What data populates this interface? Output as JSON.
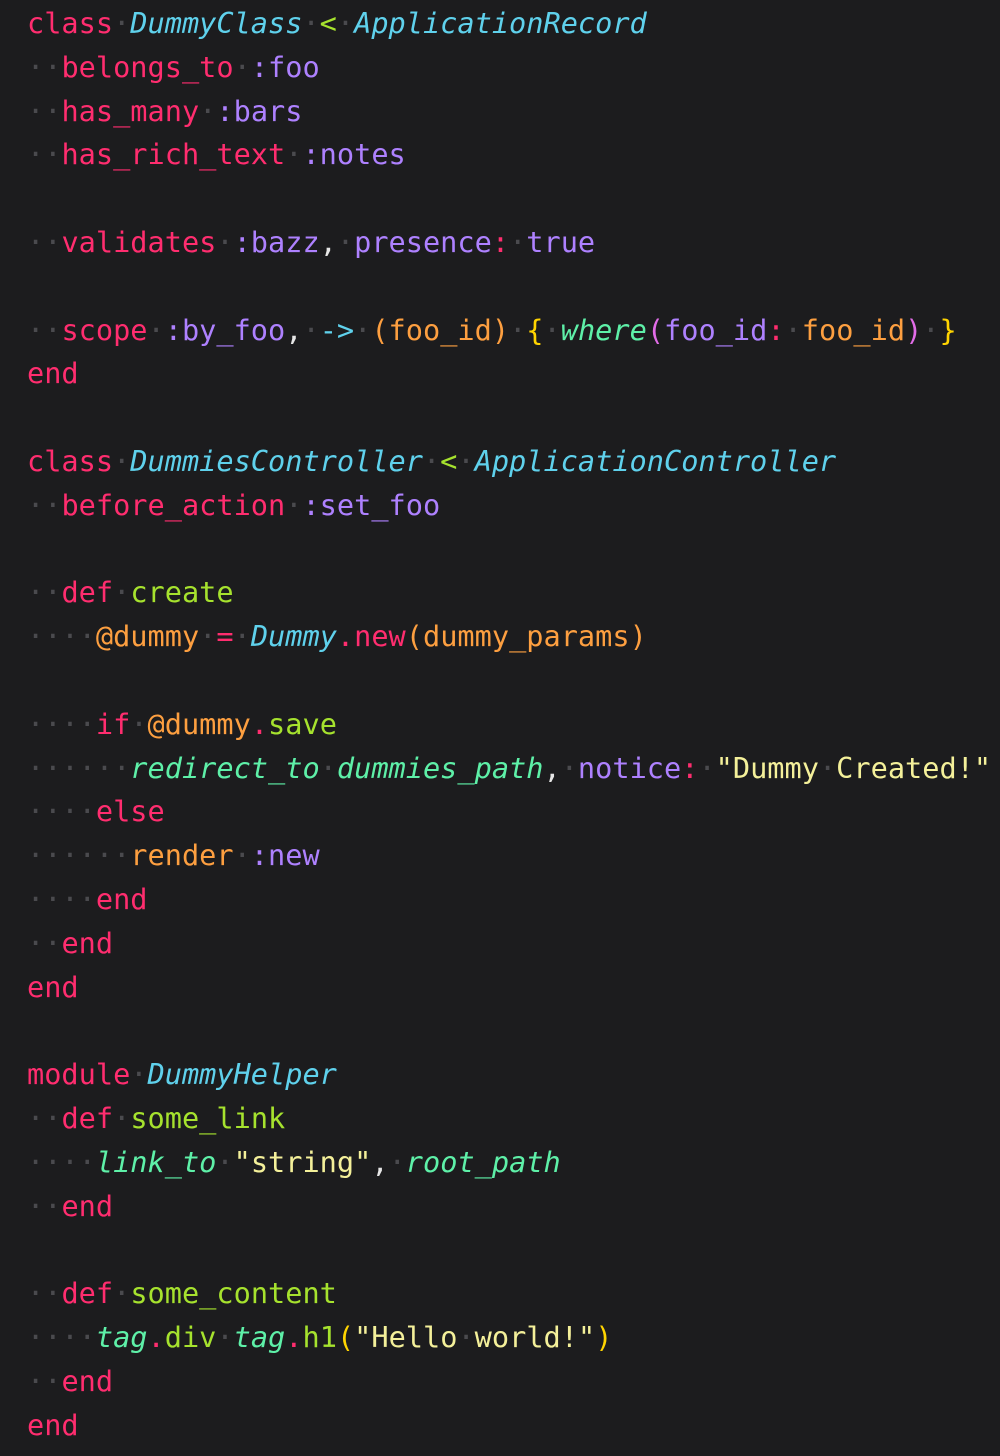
{
  "code": {
    "lines": [
      [
        [
          "kw",
          "class"
        ],
        [
          "ws",
          "·"
        ],
        [
          "cls",
          "DummyClass"
        ],
        [
          "ws",
          "·"
        ],
        [
          "op",
          "<"
        ],
        [
          "ws",
          "·"
        ],
        [
          "cls",
          "ApplicationRecord"
        ]
      ],
      [
        [
          "ws",
          "··"
        ],
        [
          "call",
          "belongs_to"
        ],
        [
          "ws",
          "·"
        ],
        [
          "sym",
          ":foo"
        ]
      ],
      [
        [
          "ws",
          "··"
        ],
        [
          "call",
          "has_many"
        ],
        [
          "ws",
          "·"
        ],
        [
          "sym",
          ":bars"
        ]
      ],
      [
        [
          "ws",
          "··"
        ],
        [
          "call",
          "has_rich_text"
        ],
        [
          "ws",
          "·"
        ],
        [
          "sym",
          ":notes"
        ]
      ],
      [],
      [
        [
          "ws",
          "··"
        ],
        [
          "call",
          "validates"
        ],
        [
          "ws",
          "·"
        ],
        [
          "sym",
          ":bazz"
        ],
        [
          "plain",
          ","
        ],
        [
          "ws",
          "·"
        ],
        [
          "sym",
          "presence"
        ],
        [
          "kw",
          ":"
        ],
        [
          "ws",
          "·"
        ],
        [
          "bool",
          "true"
        ]
      ],
      [],
      [
        [
          "ws",
          "··"
        ],
        [
          "call",
          "scope"
        ],
        [
          "ws",
          "·"
        ],
        [
          "sym",
          ":by_foo"
        ],
        [
          "plain",
          ","
        ],
        [
          "ws",
          "·"
        ],
        [
          "arrow",
          "->"
        ],
        [
          "ws",
          "·"
        ],
        [
          "var",
          "(foo_id)"
        ],
        [
          "ws",
          "·"
        ],
        [
          "brace",
          "{"
        ],
        [
          "ws",
          "·"
        ],
        [
          "fn-it",
          "where"
        ],
        [
          "paren",
          "("
        ],
        [
          "sym",
          "foo_id"
        ],
        [
          "kw",
          ":"
        ],
        [
          "ws",
          "·"
        ],
        [
          "var",
          "foo_id"
        ],
        [
          "paren",
          ")"
        ],
        [
          "ws",
          "·"
        ],
        [
          "brace",
          "}"
        ]
      ],
      [
        [
          "kw",
          "end"
        ]
      ],
      [],
      [
        [
          "kw",
          "class"
        ],
        [
          "ws",
          "·"
        ],
        [
          "cls",
          "DummiesController"
        ],
        [
          "ws",
          "·"
        ],
        [
          "op",
          "<"
        ],
        [
          "ws",
          "·"
        ],
        [
          "cls",
          "ApplicationController"
        ]
      ],
      [
        [
          "ws",
          "··"
        ],
        [
          "call",
          "before_action"
        ],
        [
          "ws",
          "·"
        ],
        [
          "sym",
          ":set_foo"
        ]
      ],
      [],
      [
        [
          "ws",
          "··"
        ],
        [
          "kw",
          "def"
        ],
        [
          "ws",
          "·"
        ],
        [
          "method",
          "create"
        ]
      ],
      [
        [
          "ws",
          "····"
        ],
        [
          "ivar",
          "@dummy"
        ],
        [
          "ws",
          "·"
        ],
        [
          "kw",
          "="
        ],
        [
          "ws",
          "·"
        ],
        [
          "cls",
          "Dummy"
        ],
        [
          "dot",
          "."
        ],
        [
          "kw",
          "new"
        ],
        [
          "var",
          "(dummy_params)"
        ]
      ],
      [],
      [
        [
          "ws",
          "····"
        ],
        [
          "kw",
          "if"
        ],
        [
          "ws",
          "·"
        ],
        [
          "ivar",
          "@dummy"
        ],
        [
          "dot",
          "."
        ],
        [
          "method",
          "save"
        ]
      ],
      [
        [
          "ws",
          "······"
        ],
        [
          "fn-it",
          "redirect_to"
        ],
        [
          "ws",
          "·"
        ],
        [
          "fn-it",
          "dummies_path"
        ],
        [
          "plain",
          ","
        ],
        [
          "ws",
          "·"
        ],
        [
          "sym",
          "notice"
        ],
        [
          "kw",
          ":"
        ],
        [
          "ws",
          "·"
        ],
        [
          "str",
          "\"Dummy"
        ],
        [
          "ws",
          "·"
        ],
        [
          "str",
          "Created!\""
        ]
      ],
      [
        [
          "ws",
          "····"
        ],
        [
          "kw",
          "else"
        ]
      ],
      [
        [
          "ws",
          "······"
        ],
        [
          "var",
          "render"
        ],
        [
          "ws",
          "·"
        ],
        [
          "sym",
          ":new"
        ]
      ],
      [
        [
          "ws",
          "····"
        ],
        [
          "kw",
          "end"
        ]
      ],
      [
        [
          "ws",
          "··"
        ],
        [
          "kw",
          "end"
        ]
      ],
      [
        [
          "kw",
          "end"
        ]
      ],
      [],
      [
        [
          "kw",
          "module"
        ],
        [
          "ws",
          "·"
        ],
        [
          "cls",
          "DummyHelper"
        ]
      ],
      [
        [
          "ws",
          "··"
        ],
        [
          "kw",
          "def"
        ],
        [
          "ws",
          "·"
        ],
        [
          "method",
          "some_link"
        ]
      ],
      [
        [
          "ws",
          "····"
        ],
        [
          "fn-it",
          "link_to"
        ],
        [
          "ws",
          "·"
        ],
        [
          "str",
          "\"string\""
        ],
        [
          "plain",
          ","
        ],
        [
          "ws",
          "·"
        ],
        [
          "fn-it",
          "root_path"
        ]
      ],
      [
        [
          "ws",
          "··"
        ],
        [
          "kw",
          "end"
        ]
      ],
      [],
      [
        [
          "ws",
          "··"
        ],
        [
          "kw",
          "def"
        ],
        [
          "ws",
          "·"
        ],
        [
          "method",
          "some_content"
        ]
      ],
      [
        [
          "ws",
          "····"
        ],
        [
          "fn-it",
          "tag"
        ],
        [
          "dot",
          "."
        ],
        [
          "method",
          "div"
        ],
        [
          "ws",
          "·"
        ],
        [
          "fn-it",
          "tag"
        ],
        [
          "dot",
          "."
        ],
        [
          "method",
          "h1"
        ],
        [
          "brace",
          "("
        ],
        [
          "str",
          "\"Hello"
        ],
        [
          "ws",
          "·"
        ],
        [
          "str",
          "world!\""
        ],
        [
          "brace",
          ")"
        ]
      ],
      [
        [
          "ws",
          "··"
        ],
        [
          "kw",
          "end"
        ]
      ],
      [
        [
          "kw",
          "end"
        ]
      ]
    ]
  }
}
